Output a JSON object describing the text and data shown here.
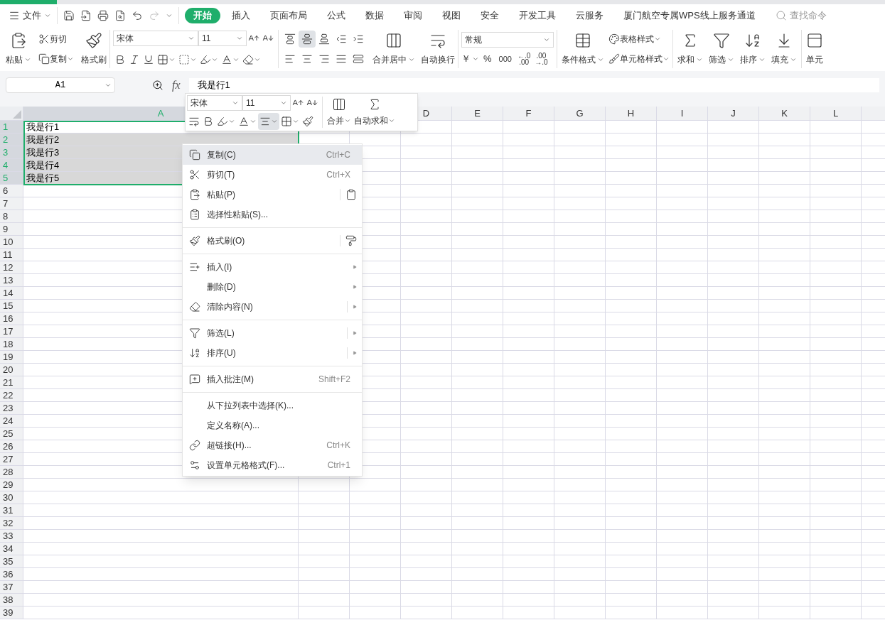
{
  "menu_bar": {
    "file_menu": "文件",
    "tabs": [
      {
        "label": "开始",
        "selected": true
      },
      {
        "label": "插入",
        "selected": false
      },
      {
        "label": "页面布局",
        "selected": false
      },
      {
        "label": "公式",
        "selected": false
      },
      {
        "label": "数据",
        "selected": false
      },
      {
        "label": "审阅",
        "selected": false
      },
      {
        "label": "视图",
        "selected": false
      },
      {
        "label": "安全",
        "selected": false
      },
      {
        "label": "开发工具",
        "selected": false
      },
      {
        "label": "云服务",
        "selected": false
      },
      {
        "label": "厦门航空专属WPS线上服务通道",
        "selected": false
      }
    ],
    "search": {
      "placeholder": "查找命令"
    }
  },
  "ribbon": {
    "paste": "粘贴",
    "cut": "剪切",
    "copy": "复制",
    "format_painter": "格式刷",
    "font": "宋体",
    "font_size": "11",
    "alignment": [
      {
        "selected": false
      },
      {
        "selected": true
      },
      {
        "selected": false
      },
      {
        "selected": false
      },
      {
        "selected": false
      },
      {
        "selected": false
      },
      {
        "selected": false
      },
      {
        "selected": false
      },
      {
        "selected": false
      },
      {
        "selected": false
      }
    ],
    "merge_center": "合并居中",
    "wrap_text": "自动换行",
    "number_format": "常规",
    "currency": "￥",
    "percent": "%",
    "thousands": "000",
    "increase_decimal": {
      "top": "←.0",
      "bottom": ".00"
    },
    "decrease_decimal": {
      "top": ".00",
      "bottom": "→.0"
    },
    "conditional_format": "条件格式",
    "table_style": "表格样式",
    "cell_style": "单元格样式",
    "sum": "求和",
    "filter": "筛选",
    "sort": "排序",
    "fill": "填充",
    "cell": "单元"
  },
  "name_box": {
    "value": "A1"
  },
  "formula_bar": {
    "label": "fx",
    "value": "我是行1"
  },
  "columns": [
    {
      "label": "A",
      "selected": true
    },
    {
      "label": "D",
      "selected": false
    },
    {
      "label": "E",
      "selected": false
    },
    {
      "label": "F",
      "selected": false
    },
    {
      "label": "G",
      "selected": false
    },
    {
      "label": "H",
      "selected": false
    },
    {
      "label": "I",
      "selected": false
    },
    {
      "label": "J",
      "selected": false
    },
    {
      "label": "K",
      "selected": false
    },
    {
      "label": "L",
      "selected": false
    }
  ],
  "rows": [
    {
      "label": "1",
      "selected": true,
      "active": true,
      "cell": "我是行1"
    },
    {
      "label": "2",
      "selected": true,
      "active": false,
      "cell": "我是行2"
    },
    {
      "label": "3",
      "selected": true,
      "active": false,
      "cell": "我是行3"
    },
    {
      "label": "4",
      "selected": true,
      "active": false,
      "cell": "我是行4"
    },
    {
      "label": "5",
      "selected": true,
      "active": false,
      "cell": "我是行5"
    },
    {
      "label": "6",
      "selected": false
    },
    {
      "label": "7",
      "selected": false
    },
    {
      "label": "8",
      "selected": false
    },
    {
      "label": "9",
      "selected": false
    },
    {
      "label": "10",
      "selected": false
    },
    {
      "label": "11",
      "selected": false
    },
    {
      "label": "12",
      "selected": false
    },
    {
      "label": "13",
      "selected": false
    },
    {
      "label": "14",
      "selected": false
    },
    {
      "label": "15",
      "selected": false
    },
    {
      "label": "16",
      "selected": false
    },
    {
      "label": "17",
      "selected": false
    },
    {
      "label": "18",
      "selected": false
    },
    {
      "label": "19",
      "selected": false
    },
    {
      "label": "20",
      "selected": false
    },
    {
      "label": "21",
      "selected": false
    },
    {
      "label": "22",
      "selected": false
    },
    {
      "label": "23",
      "selected": false
    },
    {
      "label": "24",
      "selected": false
    },
    {
      "label": "25",
      "selected": false
    },
    {
      "label": "26",
      "selected": false
    },
    {
      "label": "27",
      "selected": false
    },
    {
      "label": "28",
      "selected": false
    },
    {
      "label": "29",
      "selected": false
    },
    {
      "label": "30",
      "selected": false
    },
    {
      "label": "31",
      "selected": false
    },
    {
      "label": "32",
      "selected": false
    },
    {
      "label": "33",
      "selected": false
    },
    {
      "label": "34",
      "selected": false
    },
    {
      "label": "35",
      "selected": false
    },
    {
      "label": "36",
      "selected": false
    },
    {
      "label": "37",
      "selected": false
    },
    {
      "label": "38",
      "selected": false
    },
    {
      "label": "39",
      "selected": false
    }
  ],
  "mini_toolbar": {
    "font": "宋体",
    "font_size": "11",
    "center_align": {
      "selected": true
    },
    "merge": "合并",
    "autosum": "自动求和"
  },
  "context_menu": {
    "items": [
      {
        "kind": "item",
        "label": "复制(C)",
        "shortcut": "Ctrl+C",
        "selected": true
      },
      {
        "kind": "item",
        "label": "剪切(T)",
        "shortcut": "Ctrl+X",
        "selected": false
      },
      {
        "kind": "split",
        "label": "粘贴(P)",
        "selected": false
      },
      {
        "kind": "item",
        "label": "选择性粘贴(S)...",
        "selected": false
      },
      {
        "kind": "separator"
      },
      {
        "kind": "split",
        "label": "格式刷(O)",
        "selected": false
      },
      {
        "kind": "separator"
      },
      {
        "kind": "submenu",
        "label": "插入(I)",
        "selected": false
      },
      {
        "kind": "submenu",
        "label": "删除(D)",
        "selected": false
      },
      {
        "kind": "split-submenu",
        "label": "清除内容(N)",
        "selected": false
      },
      {
        "kind": "separator"
      },
      {
        "kind": "split-submenu",
        "label": "筛选(L)",
        "selected": false
      },
      {
        "kind": "split-submenu",
        "label": "排序(U)",
        "selected": false
      },
      {
        "kind": "separator"
      },
      {
        "kind": "item",
        "label": "插入批注(M)",
        "shortcut": "Shift+F2",
        "selected": false
      },
      {
        "kind": "separator"
      },
      {
        "kind": "item",
        "label": "从下拉列表中选择(K)...",
        "selected": false
      },
      {
        "kind": "item",
        "label": "定义名称(A)...",
        "selected": false
      },
      {
        "kind": "item",
        "label": "超链接(H)...",
        "shortcut": "Ctrl+K",
        "selected": false
      },
      {
        "kind": "item",
        "label": "设置单元格格式(F)...",
        "shortcut": "Ctrl+1",
        "selected": false
      }
    ]
  }
}
